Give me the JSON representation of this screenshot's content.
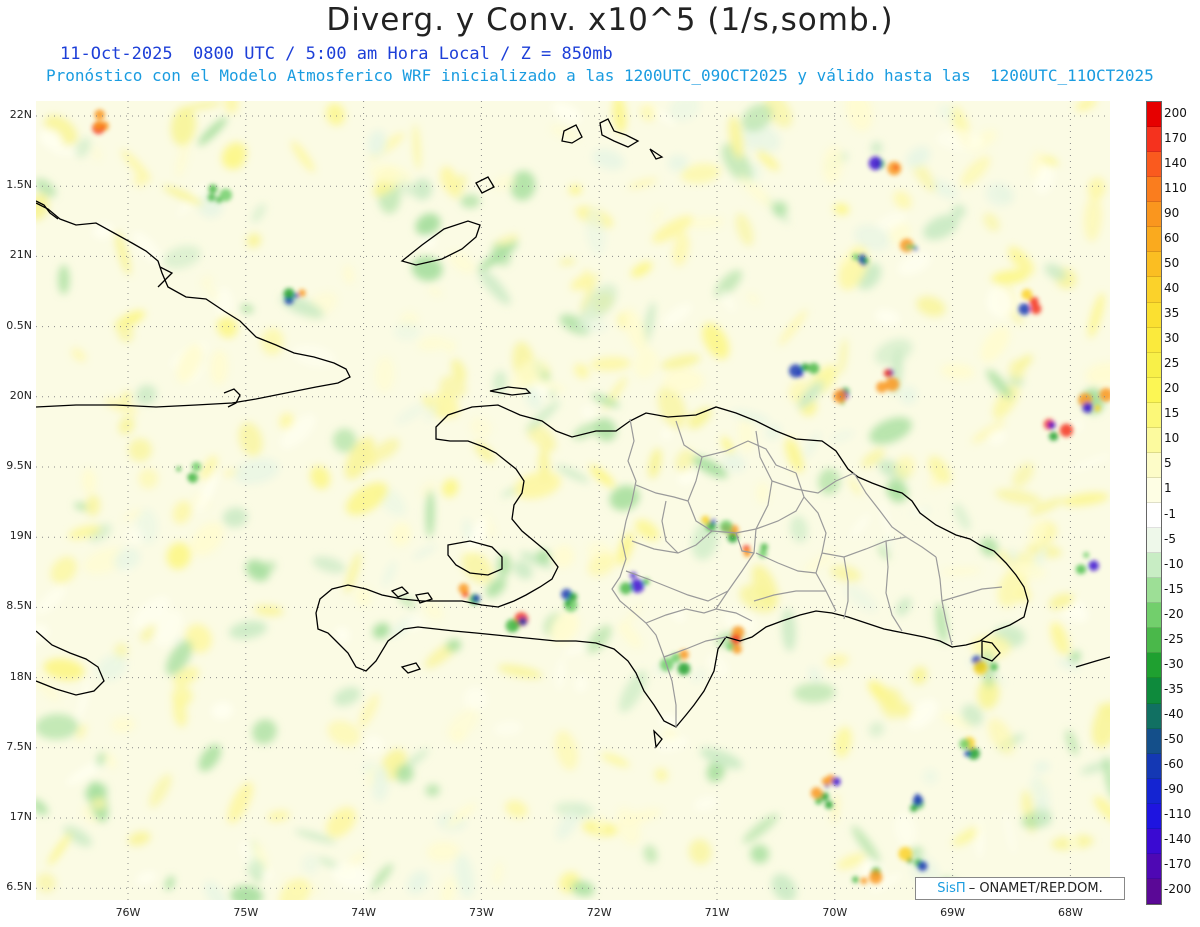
{
  "header": {
    "title": "Diverg. y Conv. x10^5 (1/s,somb.)",
    "valid_time": "11-Oct-2025  0800 UTC / 5:00 am Hora Local / Z = 850mb",
    "description": "Pronóstico con el Modelo Atmosferico WRF inicializado a las 1200UTC_09OCT2025 y válido hasta las  1200UTC_11OCT2025"
  },
  "axes": {
    "lat_labels": [
      "22N",
      "1.5N",
      "21N",
      "0.5N",
      "20N",
      "9.5N",
      "19N",
      "8.5N",
      "18N",
      "7.5N",
      "17N",
      "6.5N"
    ],
    "lon_labels": [
      "76W",
      "75W",
      "74W",
      "73W",
      "72W",
      "71W",
      "70W",
      "69W",
      "68W"
    ]
  },
  "legend": {
    "labels": [
      "200",
      "170",
      "140",
      "110",
      "90",
      "60",
      "50",
      "40",
      "35",
      "30",
      "25",
      "20",
      "15",
      "10",
      "5",
      "1",
      "-1",
      "-5",
      "-10",
      "-15",
      "-20",
      "-25",
      "-30",
      "-35",
      "-40",
      "-50",
      "-60",
      "-90",
      "-110",
      "-140",
      "-170",
      "-200"
    ],
    "colors": [
      "#e60000",
      "#f5321e",
      "#fa5a1e",
      "#fa7d1e",
      "#fa961e",
      "#faaa1e",
      "#fbbe22",
      "#fbd22a",
      "#fbe030",
      "#fbea3c",
      "#f8f048",
      "#fcf654",
      "#fcf878",
      "#fcfa9e",
      "#fdfcc8",
      "#fefee4",
      "#ffffff",
      "#eef8ea",
      "#c8edc4",
      "#9ddf96",
      "#72cf6c",
      "#4ab84a",
      "#1fa030",
      "#0e8a3c",
      "#117062",
      "#144f8a",
      "#1438b4",
      "#1424d2",
      "#1e14e0",
      "#3a0ad2",
      "#4e08b4",
      "#5a0896"
    ]
  },
  "credit": {
    "brand": "SisΠ",
    "org": "– ONAMET/REP.DOM."
  }
}
